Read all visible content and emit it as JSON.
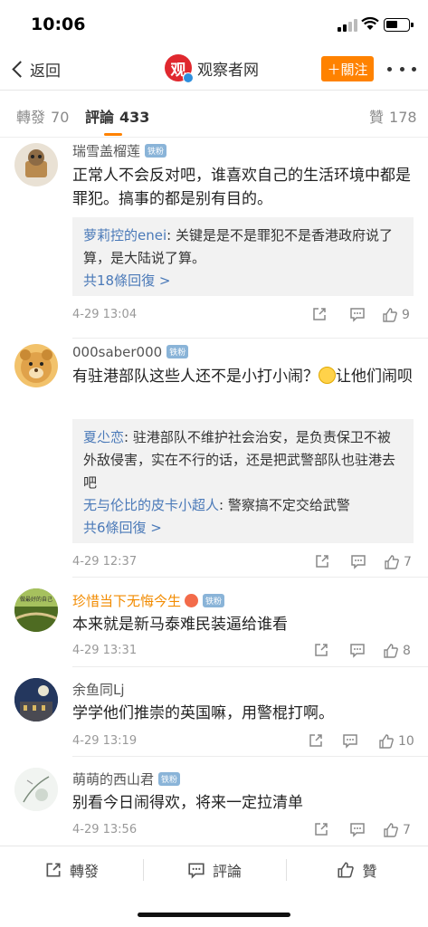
{
  "status": {
    "time": "10:06"
  },
  "nav": {
    "back": "返回",
    "title": "观察者网",
    "logo_char": "观",
    "follow": "＋關注"
  },
  "tabs": [
    {
      "label": "轉發",
      "count": "70"
    },
    {
      "label": "評論",
      "count": "433"
    },
    {
      "label": "贊",
      "count": "178"
    }
  ],
  "comments": [
    {
      "user": "瑞雪盖榴莲",
      "badge": "铁粉",
      "text": "正常人不会反对吧，谁喜欢自己的生活环境中都是罪犯。搞事的都是别有目的。",
      "replies": [
        {
          "user": "萝莉控的enei",
          "text": ": 关键是是不是罪犯不是香港政府说了算，是大陆说了算。"
        }
      ],
      "more": "共18條回復 >",
      "date": "4-29 13:04",
      "likes": "9"
    },
    {
      "user": "000saber000",
      "badge": "铁粉",
      "text_a": "有驻港部队这些人还不是小打小闹？",
      "text_b": "让他们闹呗",
      "replies": [
        {
          "user": "夏尐恋",
          "text": ": 驻港部队不维护社会治安，是负责保卫不被外敌侵害，实在不行的话，还是把武警部队也驻港去吧"
        },
        {
          "user": "无与伦比的皮卡小超人",
          "text": ": 警察搞不定交给武警"
        }
      ],
      "more": "共6條回復 >",
      "date": "4-29 12:37",
      "likes": "7"
    },
    {
      "user": "珍惜当下无悔今生",
      "badge": "铁粉",
      "avatar_text": "做最好的自己",
      "text": "本来就是新马泰难民装逼给谁看",
      "date": "4-29 13:31",
      "likes": "8"
    },
    {
      "user": "余鱼同Lj",
      "text": "学学他们推崇的英国嘛，用警棍打啊。",
      "date": "4-29 13:19",
      "likes": "10"
    },
    {
      "user": "萌萌的西山君",
      "badge": "铁粉",
      "text": "别看今日闹得欢，将来一定拉清单",
      "date": "4-29 13:56",
      "likes": "7"
    }
  ],
  "bottom": {
    "repost": "轉發",
    "comment": "評論",
    "like": "贊"
  },
  "colors": {
    "accent": "#ff8200",
    "link": "#4a79b8",
    "brand_red": "#e0282e"
  }
}
